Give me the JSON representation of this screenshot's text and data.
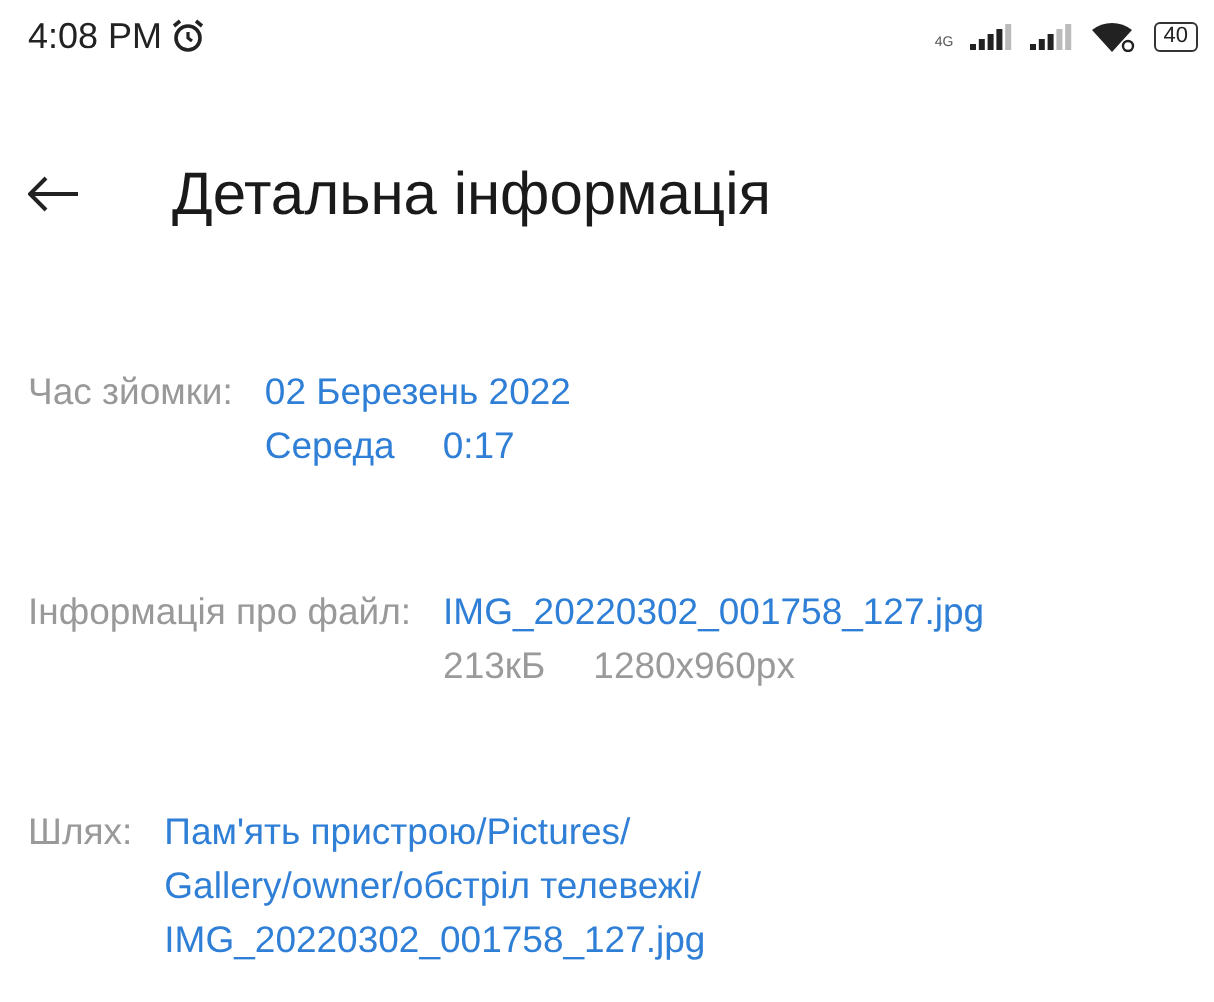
{
  "status_bar": {
    "time": "4:08 PM",
    "network_type": "4G",
    "battery": "40"
  },
  "header": {
    "title": "Детальна інформація"
  },
  "details": [
    {
      "label": "Час зйомки:",
      "lines": [
        {
          "parts": [
            "02 Березень 2022"
          ],
          "muted": false
        },
        {
          "parts": [
            "Середа",
            "0:17"
          ],
          "muted": false
        }
      ]
    },
    {
      "label": "Інформація про файл:",
      "lines": [
        {
          "parts": [
            "IMG_20220302_001758_127.jpg"
          ],
          "muted": false
        },
        {
          "parts": [
            "213кБ",
            "1280x960px"
          ],
          "muted": true
        }
      ]
    },
    {
      "label": "Шлях:",
      "lines": [
        {
          "parts": [
            "Пам'ять пристрою/Pictures/"
          ],
          "muted": false
        },
        {
          "parts": [
            "Gallery/owner/обстріл телевежі/"
          ],
          "muted": false
        },
        {
          "parts": [
            "IMG_20220302_001758_127.jpg"
          ],
          "muted": false
        }
      ]
    }
  ]
}
